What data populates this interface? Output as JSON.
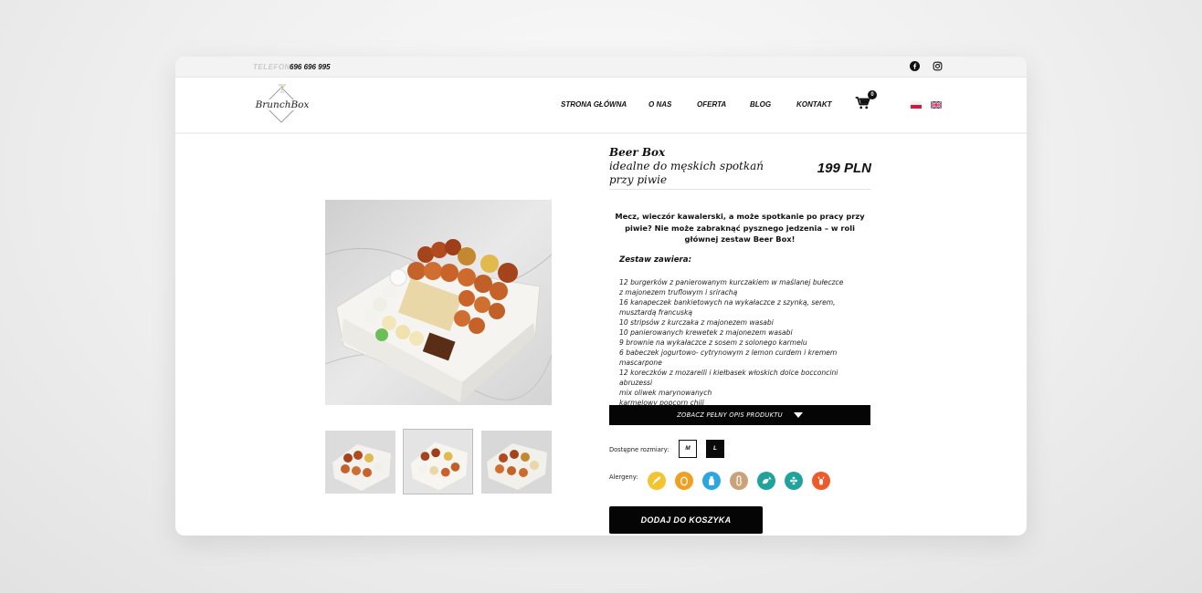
{
  "topbar": {
    "phone_label": "TELEFON:",
    "phone_number": "696 696 995"
  },
  "logo": {
    "text": "BrunchBox"
  },
  "nav": {
    "items": [
      "STRONA GŁÓWNA",
      "O NAS",
      "OFERTA",
      "BLOG",
      "KONTAKT"
    ],
    "cart_count": "0"
  },
  "languages": [
    "pl",
    "en"
  ],
  "product": {
    "name": "Beer Box",
    "subtitle": "idealne do męskich spotkań przy piwie",
    "price": "199 PLN",
    "intro": "Mecz, wieczór kawalerski, a może spotkanie po pracy przy piwie? Nie może zabraknąć pysznego jedzenia – w roli głównej zestaw Beer Box!",
    "set_title": "Zestaw zawiera:",
    "items": [
      "12 burgerków z panierowanym kurczakiem w maślanej bułeczce\nz majonezem truflowym i srirachą",
      "16 kanapeczek bankietowych na wykałaczce z szynką, serem, musztardą francuską",
      "10 stripsów z kurczaka z majonezem wasabi",
      "10 panierowanych krewetek z majonezem wasabi",
      "9 brownie na wykałaczce z sosem z solonego karmelu",
      "6 babeczek jogurtowo- cytrynowym z lemon curdem i kremem mascarpone",
      "12 koreczków z mozarelli i kiełbasek włoskich dolce bocconcini abruzessi",
      "mix oliwek marynowanych",
      "karmelowy popcorn chili"
    ],
    "full_description_button": "ZOBACZ PEŁNY OPIS PRODUKTU",
    "sizes_label": "Dostępne rozmiary:",
    "sizes": [
      "M",
      "L"
    ],
    "selected_size": "L",
    "allergens_label": "Alergeny:",
    "allergens": [
      {
        "icon": "wheat-gluten-icon",
        "color": "#f4c430"
      },
      {
        "icon": "egg-icon",
        "color": "#f0a020"
      },
      {
        "icon": "milk-icon",
        "color": "#2ba7de"
      },
      {
        "icon": "peanut-icon",
        "color": "#c9a27a"
      },
      {
        "icon": "fish-icon",
        "color": "#1fa39a"
      },
      {
        "icon": "mustard-icon",
        "color": "#1fa39a"
      },
      {
        "icon": "crustacean-icon",
        "color": "#ef5a2a"
      }
    ],
    "add_to_cart": "DODAJ DO KOSZYKA"
  }
}
